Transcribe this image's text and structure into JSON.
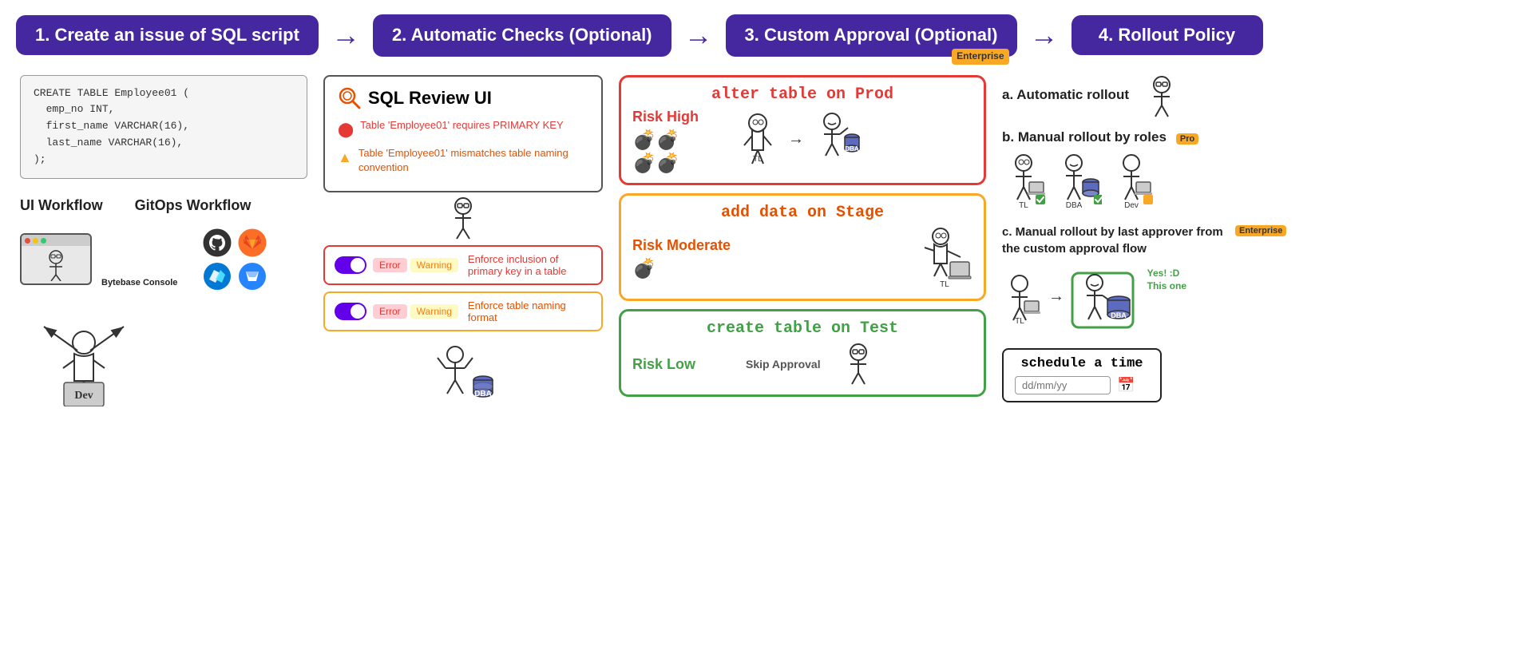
{
  "steps": [
    {
      "id": "step1",
      "label": "1. Create an issue of SQL script"
    },
    {
      "id": "step2",
      "label": "2. Automatic Checks (Optional)"
    },
    {
      "id": "step3",
      "label": "3. Custom Approval (Optional)",
      "badge": "Enterprise"
    },
    {
      "id": "step4",
      "label": "4. Rollout Policy"
    }
  ],
  "section1": {
    "code": "CREATE TABLE Employee01 (\n  emp_no INT,\n  first_name VARCHAR(16),\n  last_name VARCHAR(16),\n);",
    "workflow_labels": [
      "UI Workflow",
      "GitOps Workflow"
    ],
    "console_label": "Bytebase Console"
  },
  "section2": {
    "sql_review_title": "SQL Review UI",
    "review_items": [
      {
        "type": "error",
        "text": "Table 'Employee01' requires PRIMARY KEY"
      },
      {
        "type": "warning",
        "text": "Table 'Employee01' mismatches table naming convention"
      }
    ],
    "rules": [
      {
        "type": "error",
        "text": "Enforce inclusion of primary key in a table",
        "badge1": "Error",
        "badge2": "Warning"
      },
      {
        "type": "warning",
        "text": "Enforce table naming format",
        "badge1": "Error",
        "badge2": "Warning"
      }
    ]
  },
  "section3": {
    "boxes": [
      {
        "type": "red",
        "header": "alter table on Prod",
        "risk_label": "Risk High",
        "figures": [
          "bombs",
          "TL",
          "DBA"
        ]
      },
      {
        "type": "yellow",
        "header": "add data on Stage",
        "risk_label": "Risk Moderate",
        "figures": [
          "bomb",
          "TL"
        ]
      },
      {
        "type": "green",
        "header": "create table on Test",
        "risk_label": "Risk Low",
        "skip_label": "Skip Approval"
      }
    ]
  },
  "section4": {
    "title": "4. Rollout Policy",
    "items": [
      {
        "id": "a",
        "label": "a. Automatic rollout"
      },
      {
        "id": "b",
        "label": "b. Manual rollout by roles",
        "badge": "Pro"
      },
      {
        "id": "c",
        "label": "c. Manual rollout by last approver from the custom approval flow",
        "badge": "Enterprise"
      }
    ],
    "roles": [
      "TL",
      "DBA",
      "Dev"
    ],
    "schedule": {
      "label": "schedule a time",
      "placeholder": "dd/mm/yy"
    },
    "yes_label": "Yes! :D",
    "this_one": "This one"
  }
}
